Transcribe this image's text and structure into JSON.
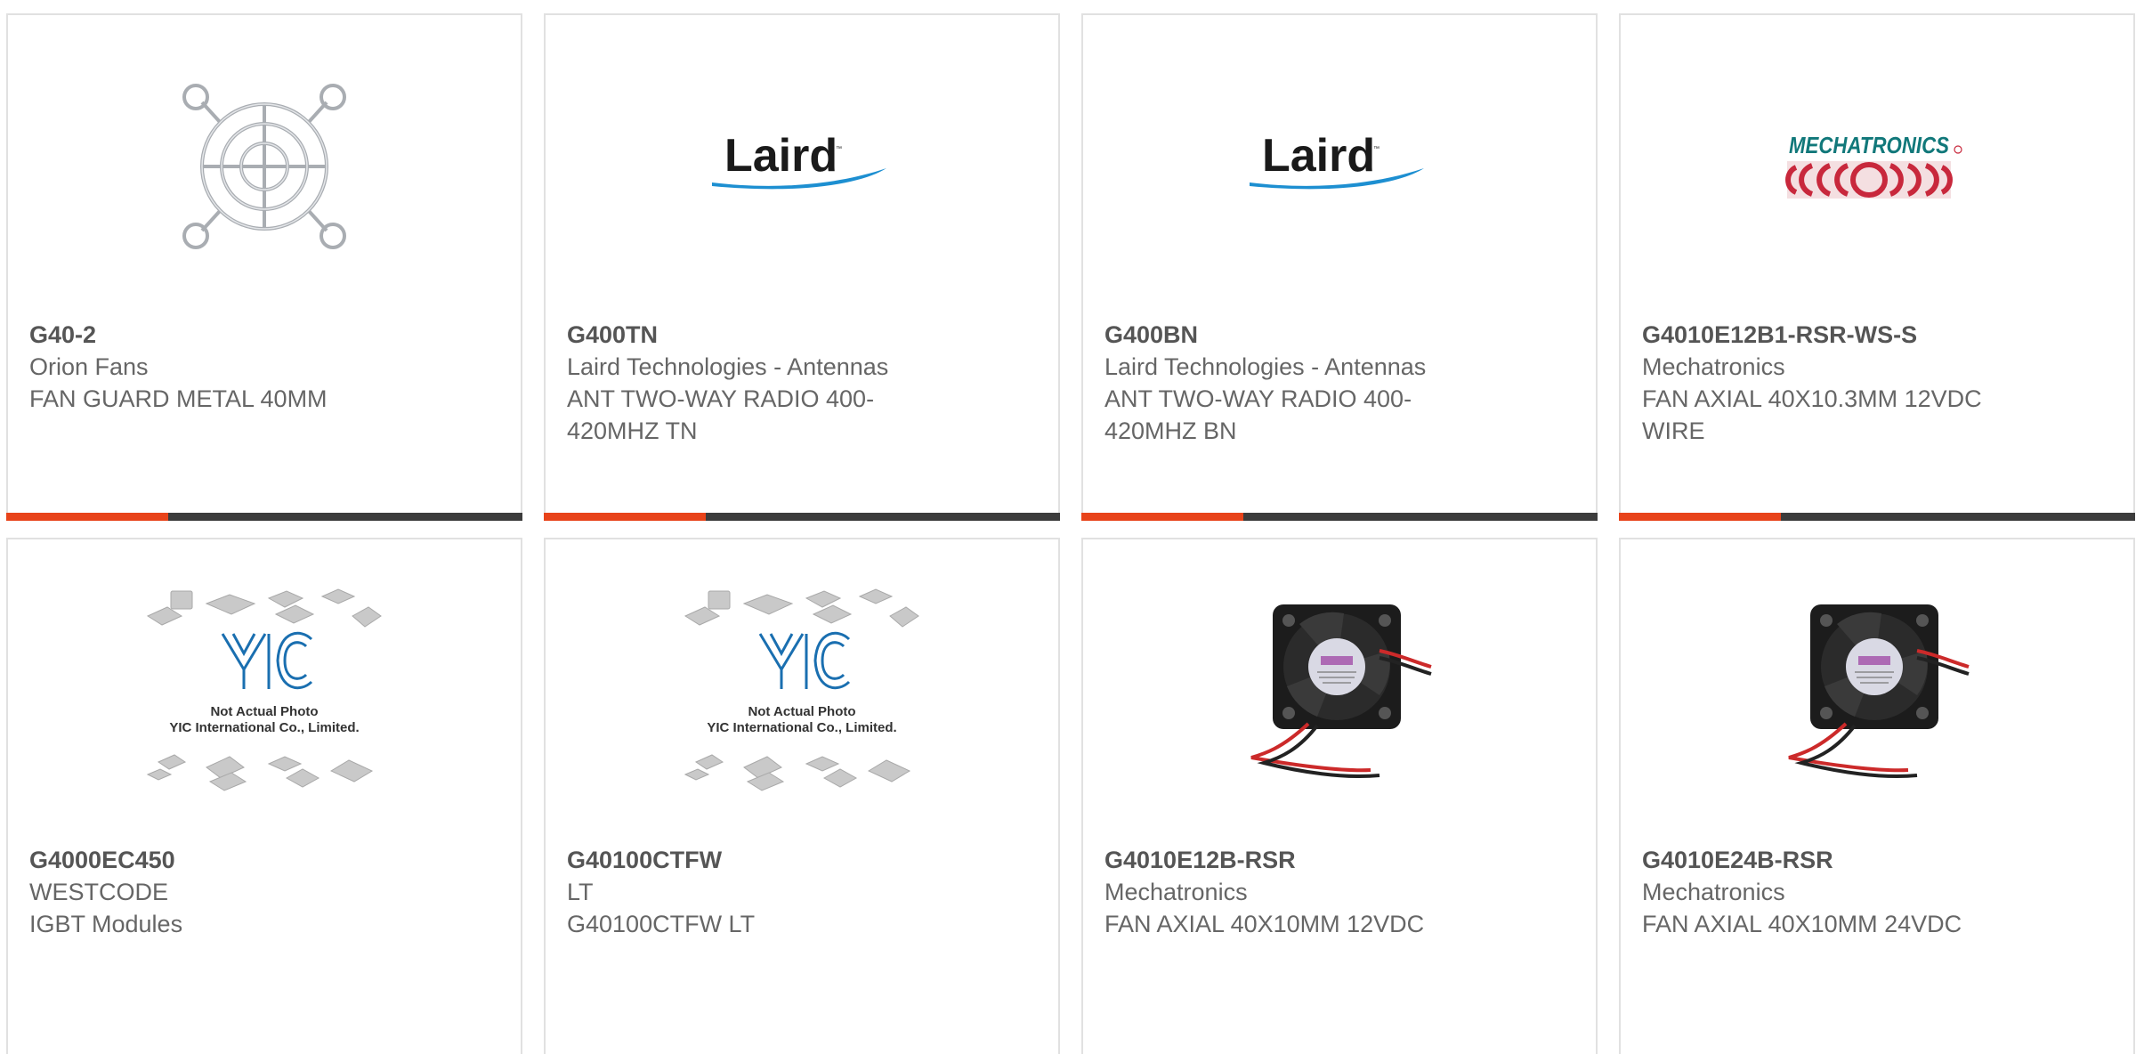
{
  "products": [
    {
      "part_number": "G40-2",
      "manufacturer": "Orion Fans",
      "description": "FAN GUARD METAL 40MM",
      "image": "fan-guard-photo"
    },
    {
      "part_number": "G400TN",
      "manufacturer": "Laird Technologies - Antennas",
      "description": "ANT TWO-WAY RADIO 400-420MHZ TN",
      "image": "laird-logo",
      "logo_text": "Laird"
    },
    {
      "part_number": "G400BN",
      "manufacturer": "Laird Technologies - Antennas",
      "description": "ANT TWO-WAY RADIO 400-420MHZ BN",
      "image": "laird-logo",
      "logo_text": "Laird"
    },
    {
      "part_number": "G4010E12B1-RSR-WS-S",
      "manufacturer": "Mechatronics",
      "description": "FAN AXIAL 40X10.3MM 12VDC WIRE",
      "image": "mechatronics-logo",
      "logo_text": "MECHATRONICS"
    },
    {
      "part_number": "G4000EC450",
      "manufacturer": "WESTCODE",
      "description": "IGBT Modules",
      "image": "not-actual-photo-placeholder",
      "placeholder_lines": [
        "Not Actual Photo",
        "YIC International Co., Limited."
      ]
    },
    {
      "part_number": "G40100CTFW",
      "manufacturer": "LT",
      "description": "G40100CTFW LT",
      "image": "not-actual-photo-placeholder",
      "placeholder_lines": [
        "Not Actual Photo",
        "YIC International Co., Limited."
      ]
    },
    {
      "part_number": "G4010E12B-RSR",
      "manufacturer": "Mechatronics",
      "description": "FAN AXIAL 40X10MM 12VDC",
      "image": "axial-fan-photo"
    },
    {
      "part_number": "G4010E24B-RSR",
      "manufacturer": "Mechatronics",
      "description": "FAN AXIAL 40X10MM 24VDC",
      "image": "axial-fan-photo"
    }
  ],
  "colors": {
    "accent": "#e8431a",
    "bar_dark": "#3c3c3c",
    "border": "#e1e1e1",
    "laird_blue": "#1d8fd1",
    "mechatronics_red": "#c8283c",
    "mechatronics_teal": "#11787a",
    "placeholder_blue": "#1a6fb0"
  }
}
